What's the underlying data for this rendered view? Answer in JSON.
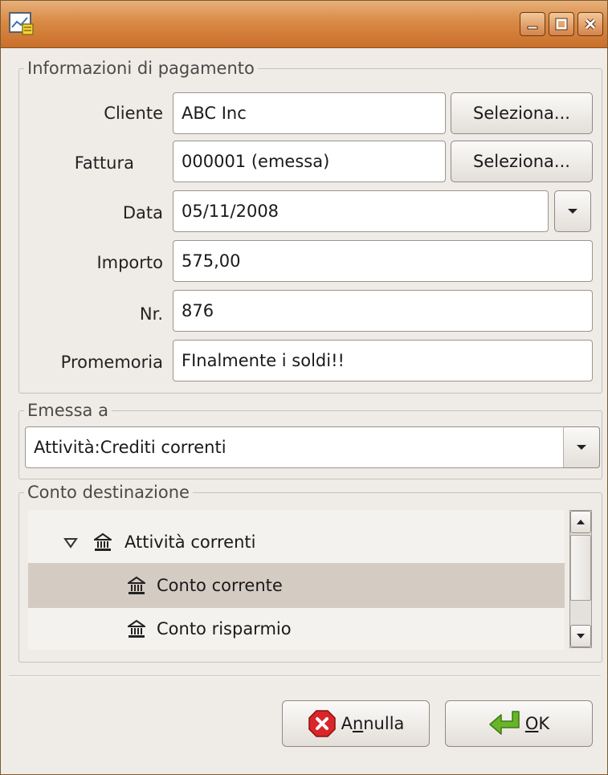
{
  "window": {
    "title": "",
    "icon": "report-icon"
  },
  "payment_info": {
    "legend": "Informazioni di pagamento",
    "customer": {
      "label": "Cliente",
      "value": "ABC Inc",
      "select_label": "Seleziona..."
    },
    "invoice": {
      "label": "Fattura",
      "value": "000001 (emessa)",
      "select_label": "Seleziona..."
    },
    "date": {
      "label": "Data",
      "value": "05/11/2008"
    },
    "amount": {
      "label": "Importo",
      "value": "575,00"
    },
    "number": {
      "label": "Nr.",
      "value": "876"
    },
    "memo": {
      "label": "Promemoria",
      "value": "FInalmente i soldi!!"
    }
  },
  "posted_to": {
    "legend": "Emessa a",
    "value": "Attività:Crediti correnti"
  },
  "transfer_account": {
    "legend": "Conto destinazione",
    "tree": [
      {
        "label": "Attività correnti",
        "expanded": true,
        "selected": false
      },
      {
        "label": "Conto corrente",
        "selected": true
      },
      {
        "label": "Conto risparmio",
        "selected": false
      }
    ]
  },
  "buttons": {
    "cancel": {
      "pre": "A",
      "mnemonic": "n",
      "post": "nulla"
    },
    "ok": {
      "pre": "",
      "mnemonic": "O",
      "post": "K"
    }
  },
  "colors": {
    "titlebar": "#d98a45",
    "selection": "#d4cbc3",
    "cancel_icon": "#d9262b",
    "ok_icon": "#6ab42a"
  }
}
